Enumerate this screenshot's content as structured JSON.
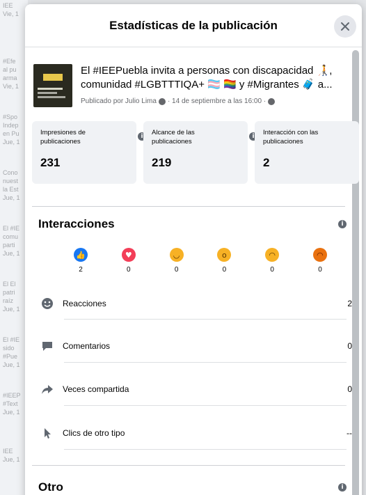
{
  "background_feed": {
    "items": [
      "IEE\nVie, 1",
      "#Efe\nal pu\narma\nVie, 1",
      "#Spo\nIndep\nen Pu\nJue, 1",
      "Cono\nnuest\nla Est\nJue, 1",
      "El #IE\ncomu\nparti\nJue, 1",
      "El El\npatri\nraíz\nJue, 1",
      "El #IE\nsido\n#Pue\nJue, 1",
      "#IEEP\n#Text\nJue, 1",
      "IEE\nJue, 1"
    ]
  },
  "modal": {
    "title": "Estadísticas de la publicación",
    "close_icon": "close-icon"
  },
  "post": {
    "text": "El #IEEPuebla invita a personas con discapacidad 🧑‍🦯, comunidad #LGBTTTIQA+ 🏳️‍⚧️ 🏳️‍🌈 y #Migrantes 🧳 a...",
    "meta": "Publicado por Julio Lima",
    "meta_date": "· 14 de septiembre a las 16:00 ·"
  },
  "stats": [
    {
      "label": "Impresiones de publicaciones",
      "value": "231"
    },
    {
      "label": "Alcance de las publicaciones",
      "value": "219"
    },
    {
      "label": "Interacción con las publicaciones",
      "value": "2"
    }
  ],
  "interactions": {
    "title": "Interacciones",
    "reactions": [
      {
        "name": "like",
        "icon": "like-icon",
        "color": "#1877f2",
        "count": "2"
      },
      {
        "name": "love",
        "icon": "heart-icon",
        "color": "#f33e58",
        "count": "0"
      },
      {
        "name": "haha",
        "icon": "laugh-icon",
        "color": "#f7b125",
        "count": "0"
      },
      {
        "name": "wow",
        "icon": "wow-icon",
        "color": "#f7b125",
        "count": "0"
      },
      {
        "name": "sad",
        "icon": "sad-icon",
        "color": "#f7b125",
        "count": "0"
      },
      {
        "name": "angry",
        "icon": "angry-icon",
        "color": "#e9710f",
        "count": "0"
      }
    ],
    "metrics": [
      {
        "label": "Reacciones",
        "icon": "smiley-icon",
        "value": "2"
      },
      {
        "label": "Comentarios",
        "icon": "comment-icon",
        "value": "0"
      },
      {
        "label": "Veces compartida",
        "icon": "share-icon",
        "value": "0"
      },
      {
        "label": "Clics de otro tipo",
        "icon": "cursor-icon",
        "value": "--"
      }
    ]
  },
  "other": {
    "title": "Otro"
  }
}
